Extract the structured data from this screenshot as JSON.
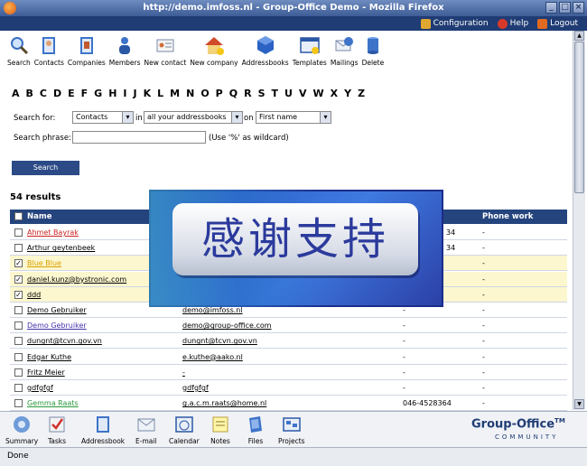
{
  "window": {
    "title": "http://demo.imfoss.nl - Group-Office Demo - Mozilla Firefox"
  },
  "gobar": [
    {
      "label": "Configuration",
      "icon": "wrench-icon",
      "color": "#e0a830"
    },
    {
      "label": "Help",
      "icon": "help-icon",
      "color": "#d83a2a"
    },
    {
      "label": "Logout",
      "icon": "logout-icon",
      "color": "#e06a20"
    }
  ],
  "toolbar": [
    {
      "label": "Search",
      "icon": "search-icon"
    },
    {
      "label": "Contacts",
      "icon": "contacts-icon"
    },
    {
      "label": "Companies",
      "icon": "companies-icon"
    },
    {
      "label": "Members",
      "icon": "members-icon"
    },
    {
      "label": "New contact",
      "icon": "new-contact-icon"
    },
    {
      "label": "New company",
      "icon": "new-company-icon"
    },
    {
      "label": "Addressbooks",
      "icon": "addressbooks-icon"
    },
    {
      "label": "Templates",
      "icon": "templates-icon"
    },
    {
      "label": "Mailings",
      "icon": "mailings-icon"
    },
    {
      "label": "Delete",
      "icon": "delete-icon"
    }
  ],
  "alphabet": [
    "A",
    "B",
    "C",
    "D",
    "E",
    "F",
    "G",
    "H",
    "I",
    "J",
    "K",
    "L",
    "M",
    "N",
    "O",
    "P",
    "Q",
    "R",
    "S",
    "T",
    "U",
    "V",
    "W",
    "X",
    "Y",
    "Z"
  ],
  "search": {
    "for_label": "Search for:",
    "for_value": "Contacts",
    "in_label": "in",
    "in_value": "all your addressbooks",
    "on_label": "on",
    "on_value": "First name",
    "phrase_label": "Search phrase:",
    "phrase_value": "",
    "wildcard_hint": "(Use '%' as wildcard)",
    "button": "Search"
  },
  "results": {
    "count_text": "54 results"
  },
  "table": {
    "columns": {
      "name": "Name",
      "phone_work": "Phone work"
    },
    "rows": [
      {
        "name": "Ahmet Bayrak",
        "name_color": "#cc2222",
        "email": "",
        "phone": "34",
        "phone_work": "-",
        "checked": false,
        "selected": false
      },
      {
        "name": "Arthur geytenbeek",
        "name_color": "#000000",
        "email": "",
        "phone": "34",
        "phone_work": "-",
        "checked": false,
        "selected": false
      },
      {
        "name": "Blue Blue",
        "name_color": "#d9a000",
        "email": "",
        "phone": "",
        "phone_work": "-",
        "checked": true,
        "selected": true
      },
      {
        "name": "daniel.kunz@bystronic.com",
        "name_color": "#000000",
        "email": "",
        "phone": "",
        "phone_work": "-",
        "checked": true,
        "selected": true
      },
      {
        "name": "ddd",
        "name_color": "#000000",
        "email": "",
        "phone": "",
        "phone_work": "-",
        "checked": true,
        "selected": true
      },
      {
        "name": "Demo Gebruiker",
        "name_color": "#000000",
        "email": "demo@imfoss.nl",
        "phone": "-",
        "phone_work": "-",
        "checked": false,
        "selected": false
      },
      {
        "name": "Demo Gebruiker",
        "name_color": "#4433aa",
        "email": "demo@group-office.com",
        "phone": "-",
        "phone_work": "-",
        "checked": false,
        "selected": false
      },
      {
        "name": "dungnt@tcvn.gov.vn",
        "name_color": "#000000",
        "email": "dungnt@tcvn.gov.vn",
        "phone": "-",
        "phone_work": "-",
        "checked": false,
        "selected": false
      },
      {
        "name": "Edgar Kuthe",
        "name_color": "#000000",
        "email": "e.kuthe@aako.nl",
        "phone": "-",
        "phone_work": "-",
        "checked": false,
        "selected": false
      },
      {
        "name": "Fritz Meier",
        "name_color": "#000000",
        "email": "-",
        "phone": "-",
        "phone_work": "-",
        "checked": false,
        "selected": false
      },
      {
        "name": "gdfgfgf",
        "name_color": "#000000",
        "email": "gdfgfgf",
        "phone": "-",
        "phone_work": "-",
        "checked": false,
        "selected": false
      },
      {
        "name": "Gemma Raats",
        "name_color": "#2a9a3a",
        "email": "g.a.c.m.raats@home.nl",
        "phone": "046-4528364",
        "phone_work": "-",
        "checked": false,
        "selected": false
      }
    ]
  },
  "modules": [
    {
      "label": "Summary",
      "icon": "summary-icon"
    },
    {
      "label": "Tasks",
      "icon": "tasks-icon"
    },
    {
      "label": "Addressbook",
      "icon": "addressbook-icon"
    },
    {
      "label": "E-mail",
      "icon": "email-icon"
    },
    {
      "label": "Calendar",
      "icon": "calendar-icon"
    },
    {
      "label": "Notes",
      "icon": "notes-icon"
    },
    {
      "label": "Files",
      "icon": "files-icon"
    },
    {
      "label": "Projects",
      "icon": "projects-icon"
    }
  ],
  "logo": {
    "main": "Group-Office",
    "tm": "TM",
    "sub": "COMMUNITY"
  },
  "overlay": {
    "text": "感谢支持"
  },
  "status": {
    "text": "Done"
  }
}
